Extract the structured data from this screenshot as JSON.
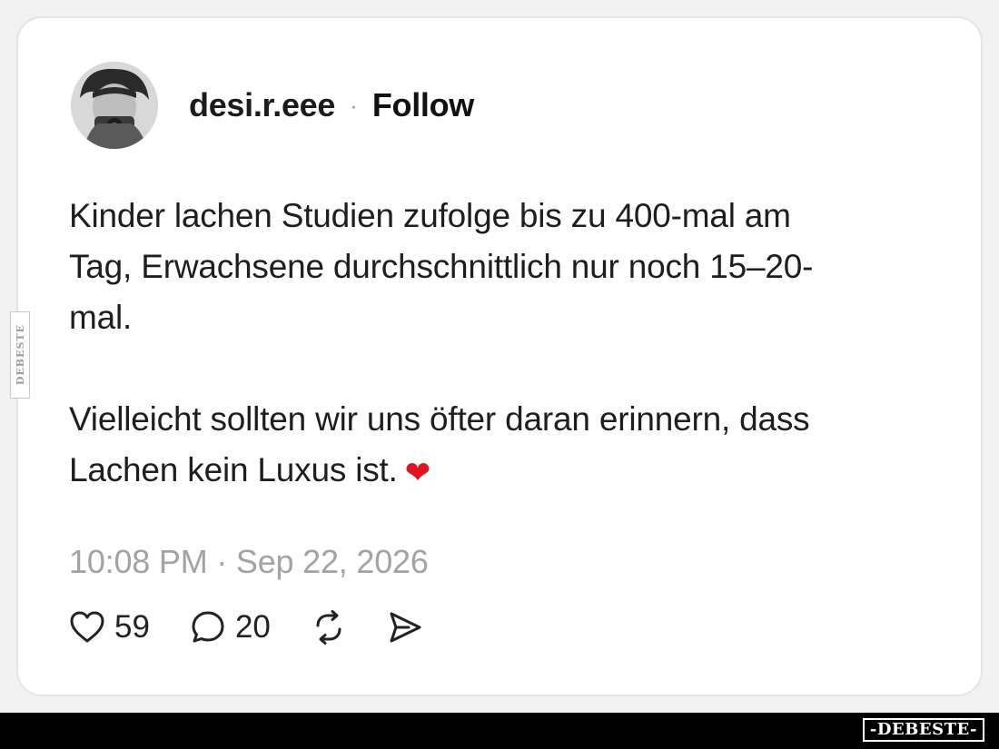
{
  "post": {
    "username": "desi.r.eee",
    "separator": "·",
    "follow_label": "Follow",
    "paragraph1_lines": [
      "Kinder lachen Studien zufolge bis zu 400-mal am",
      "Tag, Erwachsene durchschnittlich nur noch 15–20-",
      "mal."
    ],
    "paragraph2_lines": [
      "Vielleicht sollten wir uns öfter daran erinnern, dass",
      "Lachen kein Luxus ist."
    ],
    "emoji": "❤",
    "timestamp": "10:08 PM · Sep 22, 2026",
    "likes": "59",
    "replies": "20"
  },
  "watermark": {
    "side_text": "DEBESTE",
    "logo_text": "-DEBESTE-"
  },
  "icons": {
    "like": "heart-outline-icon",
    "reply": "speech-bubble-icon",
    "repost": "repost-icon",
    "share": "send-icon"
  },
  "colors": {
    "card_background": "#ffffff",
    "heart_emoji": "#e0141e",
    "timestamp": "#a3a3a3",
    "footer_bar": "#000000"
  }
}
